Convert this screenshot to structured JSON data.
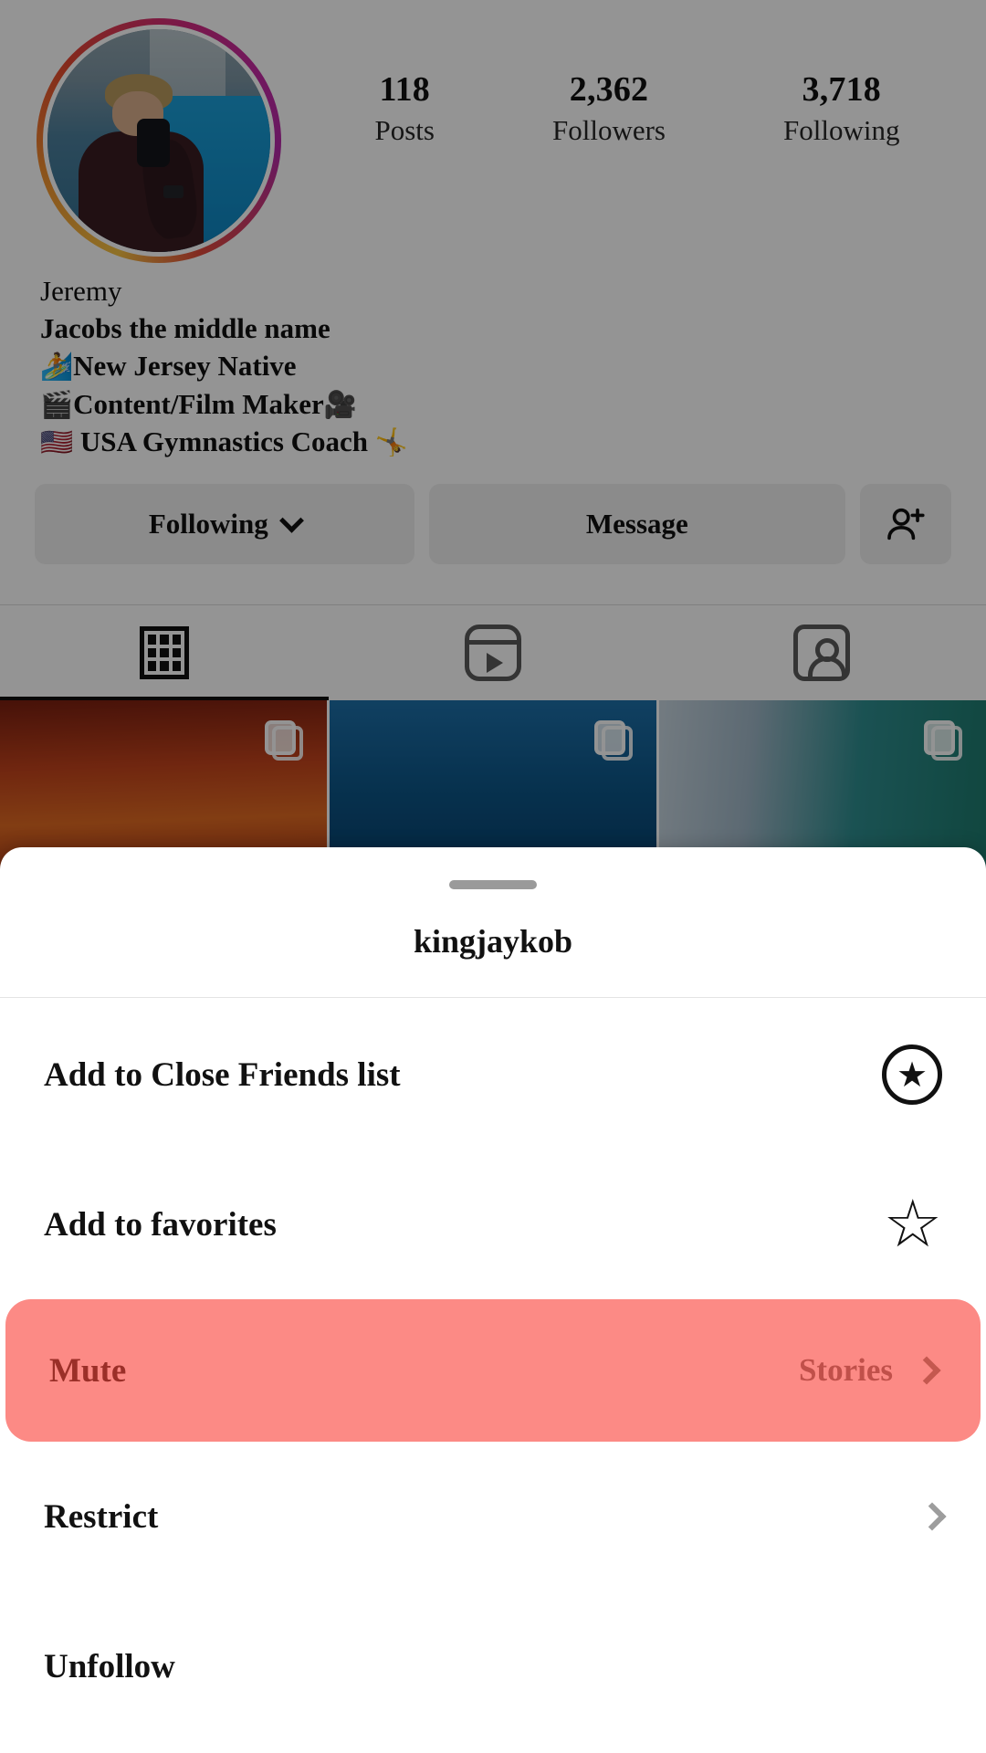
{
  "profile": {
    "stats": [
      {
        "value": "118",
        "label": "Posts"
      },
      {
        "value": "2,362",
        "label": "Followers"
      },
      {
        "value": "3,718",
        "label": "Following"
      }
    ],
    "name": "Jeremy",
    "bio": [
      {
        "emoji": "🏄",
        "text": "New Jersey Native",
        "icon_name": "surfer-emoji"
      },
      {
        "emoji": "🎬",
        "text": "Content/Film Maker",
        "trailing_emoji": "🎥",
        "icon_name": "clapper-board-emoji"
      },
      {
        "emoji": "🇺🇸",
        "text": " USA Gymnastics Coach ",
        "trailing_emoji": "🤸",
        "icon_name": "usa-flag-emoji"
      }
    ],
    "bio_subtitle": "Jacobs the middle name",
    "buttons": {
      "following": "Following",
      "message": "Message",
      "add_person_icon": "add-person-icon"
    },
    "tabs": [
      {
        "icon_name": "grid-icon",
        "active": true
      },
      {
        "icon_name": "reels-icon",
        "active": false
      },
      {
        "icon_name": "tagged-icon",
        "active": false
      }
    ],
    "avatar_icon": "profile-avatar",
    "grid_badge_icon": "carousel-icon"
  },
  "sheet": {
    "handle_icon": "drag-handle",
    "title": "kingjaykob",
    "rows": [
      {
        "label": "Add to Close Friends list",
        "icon_name": "close-friends-star-icon",
        "glyph": "★",
        "type": "circle-star"
      },
      {
        "label": "Add to favorites",
        "icon_name": "favorites-star-icon",
        "glyph": "☆",
        "type": "outline-star"
      },
      {
        "label": "Mute",
        "value": "Stories",
        "icon_name": "chevron-right-icon",
        "type": "highlighted",
        "highlight_color": "#fc8a85",
        "text_color": "#9b2f28"
      },
      {
        "label": "Restrict",
        "value": "",
        "icon_name": "chevron-right-icon",
        "type": "chevron"
      },
      {
        "label": "Unfollow",
        "value": "",
        "icon_name": "",
        "type": "plain"
      }
    ]
  }
}
